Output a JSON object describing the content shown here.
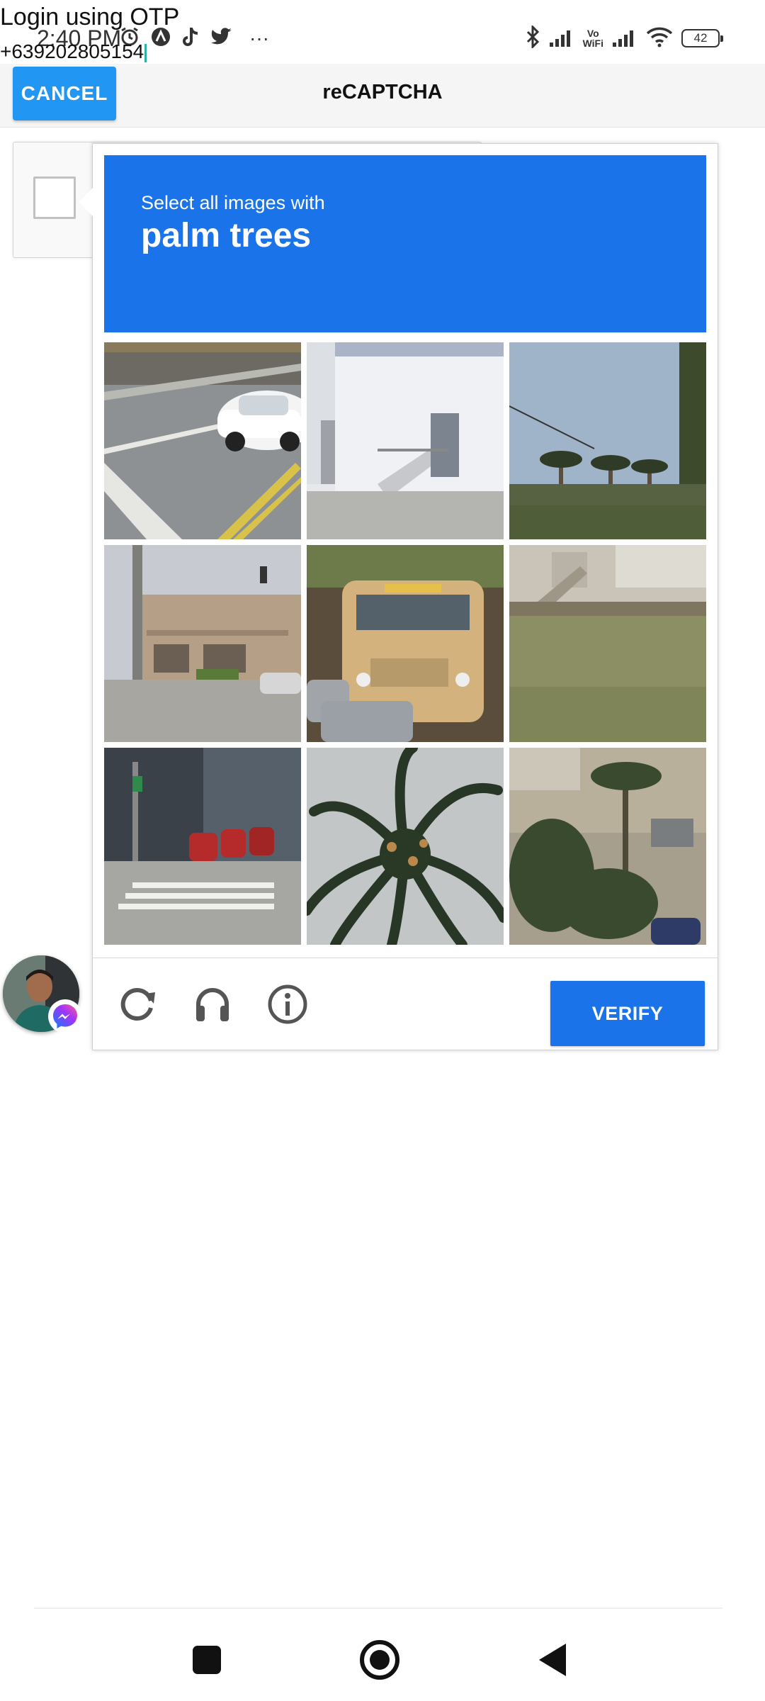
{
  "overlay": {
    "title": "Login using OTP",
    "phone": "+639202805154"
  },
  "status_bar": {
    "time": "2:40 PM",
    "left_icons": [
      "alarm-icon",
      "notification-a-icon",
      "tiktok-icon",
      "twitter-icon",
      "more-dots-icon"
    ],
    "more": "···",
    "right_icons": [
      "bluetooth-icon",
      "signal-icon",
      "vowifi-icon",
      "signal-icon",
      "wifi-icon",
      "battery-icon"
    ],
    "vowifi_top": "Vo",
    "vowifi_bottom": "WiFi",
    "battery": "42"
  },
  "app_bar": {
    "cancel_label": "CANCEL",
    "title": "reCAPTCHA"
  },
  "challenge": {
    "prompt": "Select all images with",
    "target": "palm trees",
    "tiles": [
      "street crosswalk with white car",
      "white building with stairs",
      "palm trees along road",
      "street corner with building and traffic light",
      "yellow school bus",
      "house on grassy hill",
      "street with red motorcycles",
      "palm tree closeup",
      "houses with palm trees"
    ],
    "reload_icon": "reload-icon",
    "audio_icon": "headphones-icon",
    "info_icon": "info-icon",
    "verify_label": "VERIFY",
    "brand_color": "#1a73e8"
  },
  "chat_head": {
    "icon": "messenger-icon"
  },
  "nav_bar": {
    "icons": [
      "recent-apps-icon",
      "home-icon",
      "back-icon"
    ]
  }
}
